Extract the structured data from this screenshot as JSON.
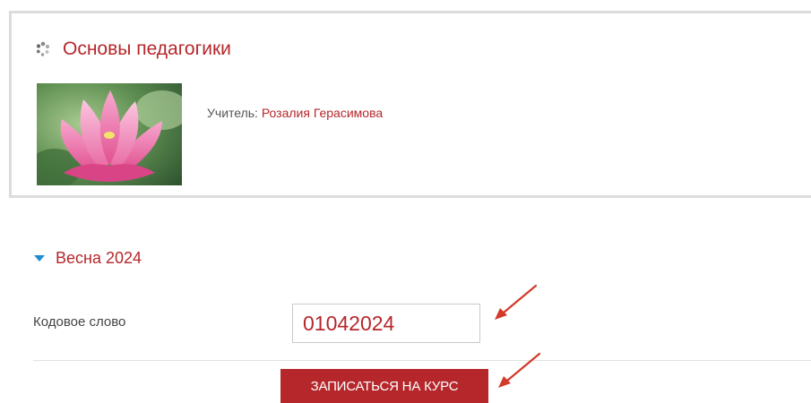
{
  "course": {
    "title": "Основы педагогики",
    "teacher_label": "Учитель:",
    "teacher_name": "Розалия Герасимова",
    "image_subject": "pink-lotus-flower"
  },
  "enrolment": {
    "section_title": "Весна 2024",
    "code_label": "Кодовое слово",
    "code_value": "01042024",
    "enroll_button_label": "ЗАПИСАТЬСЯ НА КУРС"
  },
  "colors": {
    "accent_red": "#b5272b",
    "caret_blue": "#1f8ed1",
    "annotation_arrow": "#d23a2a"
  }
}
